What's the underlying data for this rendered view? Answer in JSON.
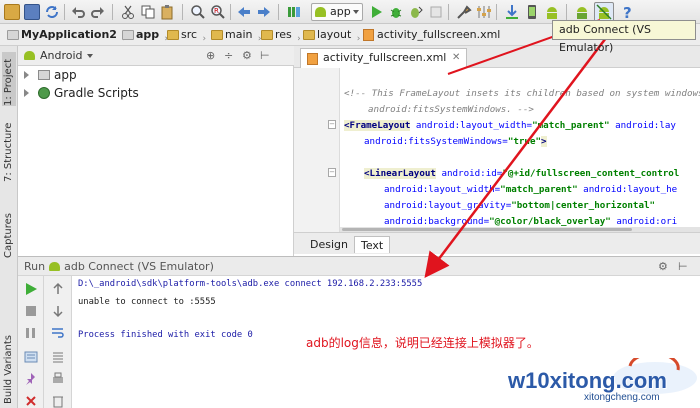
{
  "toolbar": {
    "run_config": "app",
    "tooltip": "adb Connect (VS Emulator)",
    "buttons": [
      "open-icon",
      "save-icon",
      "sync-icon",
      "undo-icon",
      "redo-icon",
      "cut-icon",
      "copy-icon",
      "paste-icon",
      "find-icon",
      "replace-icon",
      "back-icon",
      "forward-icon",
      "build-icon",
      "run-icon",
      "debug-icon",
      "attach-icon",
      "stop-icon",
      "project-structure-icon",
      "sdk-manager-icon",
      "avd-manager-icon",
      "android-device-monitor-icon",
      "adb-connect-icon",
      "help-icon"
    ]
  },
  "breadcrumb": {
    "items": [
      "MyApplication2",
      "app",
      "src",
      "main",
      "res",
      "layout",
      "activity_fullscreen.xml"
    ]
  },
  "left_tabs": {
    "project": "1: Project",
    "structure": "7: Structure",
    "captures": "Captures",
    "build_variants": "Build Variants"
  },
  "project_panel": {
    "view_selector": "Android",
    "tree": [
      "app",
      "Gradle Scripts"
    ]
  },
  "editor": {
    "tab": "activity_fullscreen.xml",
    "code": {
      "l1_comment_a": "<!-- This FrameLayout insets its children based on system windows usi",
      "l2_comment_b": "android:fitsSystemWindows. -->",
      "l3_tag": "<FrameLayout",
      "l3_attr1": " android:layout_width=",
      "l3_val1": "\"match_parent\"",
      "l3_attr2": " android:lay",
      "l4_attr": "android:fitsSystemWindows=",
      "l4_val": "\"true\"",
      "l4_end": ">",
      "l6_tag": "<LinearLayout",
      "l6_attr": " android:id=",
      "l6_val": "\"@+id/fullscreen_content_control",
      "l7_attr1": "android:layout_width=",
      "l7_val1": "\"match_parent\"",
      "l7_attr2": " android:layout_he",
      "l8_attr": "android:layout_gravity=",
      "l8_val": "\"bottom|center_horizontal\"",
      "l9_attr1": "android:background=",
      "l9_val1": "\"@color/black_overlay\"",
      "l9_attr2": " android:ori"
    },
    "bottom_tabs": [
      "Design",
      "Text"
    ]
  },
  "run_panel": {
    "run_label": "Run",
    "config_name": "adb Connect (VS Emulator)",
    "console": {
      "cmd": "D:\\_android\\sdk\\platform-tools\\adb.exe connect 192.168.2.233:5555",
      "error": "unable to connect to :5555",
      "finished": "Process finished with exit code 0"
    },
    "annotation": "adb的log信息，说明已经连接上模拟器了。"
  },
  "watermark": {
    "brand": "w10xitong.com",
    "url": "xitongcheng.com"
  }
}
